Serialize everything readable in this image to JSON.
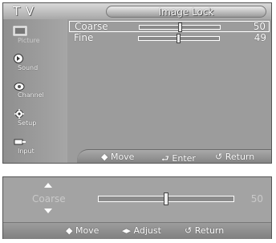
{
  "menu": {
    "section_label": "T V",
    "title": "Image Lock",
    "sidebar": [
      {
        "label": "Picture",
        "icon": "picture-icon",
        "active": true
      },
      {
        "label": "Sound",
        "icon": "sound-icon",
        "active": false
      },
      {
        "label": "Channel",
        "icon": "channel-icon",
        "active": false
      },
      {
        "label": "Setup",
        "icon": "setup-icon",
        "active": false
      },
      {
        "label": "Input",
        "icon": "input-icon",
        "active": false
      }
    ],
    "items": [
      {
        "name": "Coarse",
        "value": "50",
        "level": 0.5
      },
      {
        "name": "Fine",
        "value": "49",
        "level": 0.49
      }
    ],
    "footer": {
      "move": "◆ Move",
      "enter": "⮐ Enter",
      "return": "↺ Return"
    }
  },
  "osd": {
    "name": "Coarse",
    "value": "50",
    "level": 0.5,
    "footer": {
      "move": "◆ Move",
      "adjust": "◂▸ Adjust",
      "return": "↺ Return"
    }
  }
}
